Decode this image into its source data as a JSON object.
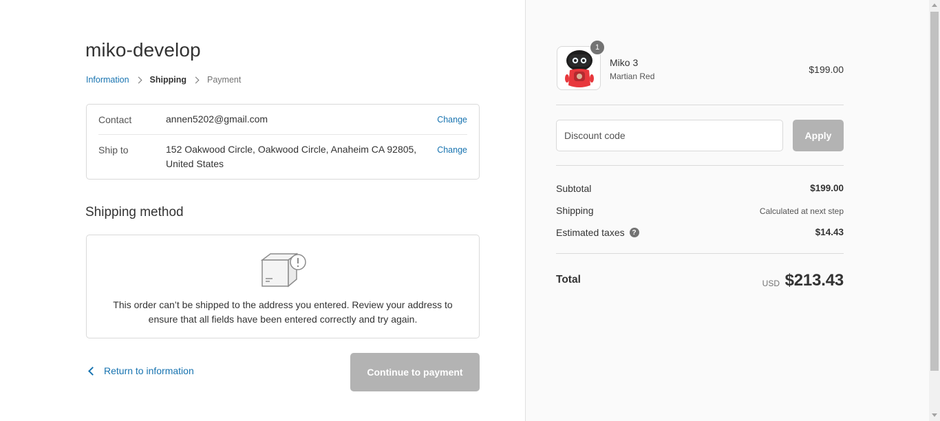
{
  "store": {
    "name": "miko-develop"
  },
  "breadcrumb": {
    "information": "Information",
    "shipping": "Shipping",
    "payment": "Payment"
  },
  "review": {
    "contact_label": "Contact",
    "contact_value": "annen5202@gmail.com",
    "ship_label": "Ship to",
    "ship_value": "152 Oakwood Circle, Oakwood Circle, Anaheim CA 92805, United States",
    "change_label": "Change"
  },
  "shipping_method": {
    "title": "Shipping method",
    "message": "This order can’t be shipped to the address you entered. Review your address to ensure that all fields have been entered correctly and try again.",
    "icon": "package-alert-icon"
  },
  "actions": {
    "return_label": "Return to information",
    "continue_label": "Continue to payment"
  },
  "cart": {
    "items": [
      {
        "name": "Miko 3",
        "variant": "Martian Red",
        "price": "$199.00",
        "quantity": "1"
      }
    ],
    "discount_placeholder": "Discount code",
    "apply_label": "Apply",
    "subtotal_label": "Subtotal",
    "subtotal_value": "$199.00",
    "shipping_label": "Shipping",
    "shipping_value": "Calculated at next step",
    "taxes_label": "Estimated taxes",
    "taxes_value": "$14.43",
    "total_label": "Total",
    "total_currency": "USD",
    "total_value": "$213.43"
  },
  "colors": {
    "link": "#1773b0",
    "disabled_button": "#b3b3b3",
    "sidebar_bg": "#fafafa"
  }
}
